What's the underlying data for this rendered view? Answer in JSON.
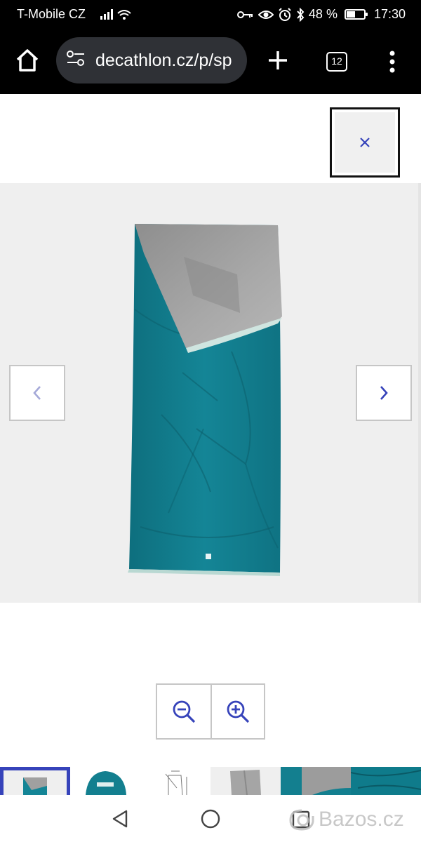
{
  "status_bar": {
    "carrier": "T-Mobile CZ",
    "battery": "48 %",
    "time": "17:30",
    "icons": [
      "signal-icon",
      "wifi-icon",
      "key-icon",
      "eye-icon",
      "alarm-icon",
      "bluetooth-icon",
      "battery-icon"
    ]
  },
  "browser": {
    "url": "decathlon.cz/p/sp",
    "tab_count": "12",
    "icons": [
      "home-icon",
      "site-settings-icon",
      "plus-icon",
      "menu-icon"
    ]
  },
  "modal": {
    "close_label": "×"
  },
  "gallery": {
    "current_index": 1,
    "thumbnail_count": 6,
    "colors": {
      "background": "#efefef",
      "accent": "#3643ba",
      "teal": "#137f8f",
      "grey_lining": "#9c9c9c"
    }
  },
  "zoom": {
    "icons": [
      "zoom-out-icon",
      "zoom-in-icon"
    ]
  },
  "watermark": {
    "text": "Bazos.cz"
  }
}
